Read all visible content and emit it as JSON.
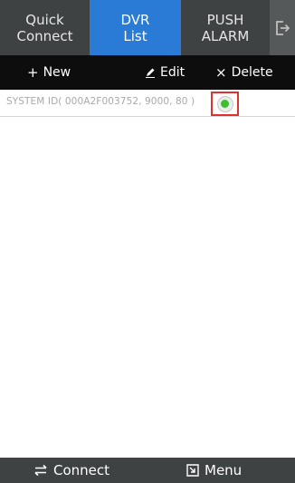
{
  "tabs": [
    {
      "line1": "Quick",
      "line2": "Connect"
    },
    {
      "line1": "DVR",
      "line2": "List"
    },
    {
      "line1": "PUSH",
      "line2": "ALARM"
    }
  ],
  "toolbar": {
    "new_label": "New",
    "edit_label": "Edit",
    "delete_label": "Delete"
  },
  "list": {
    "items": [
      {
        "text": "SYSTEM ID( 000A2F003752, 9000, 80 )",
        "status": "connected"
      }
    ]
  },
  "bottom": {
    "connect_label": "Connect",
    "menu_label": "Menu"
  },
  "colors": {
    "active_tab": "#2a7bd6",
    "tab_bg": "#3f4243",
    "toolbar_bg": "#0d0d0d",
    "status_green": "#3bbf2c",
    "highlight_red": "#e03030"
  }
}
